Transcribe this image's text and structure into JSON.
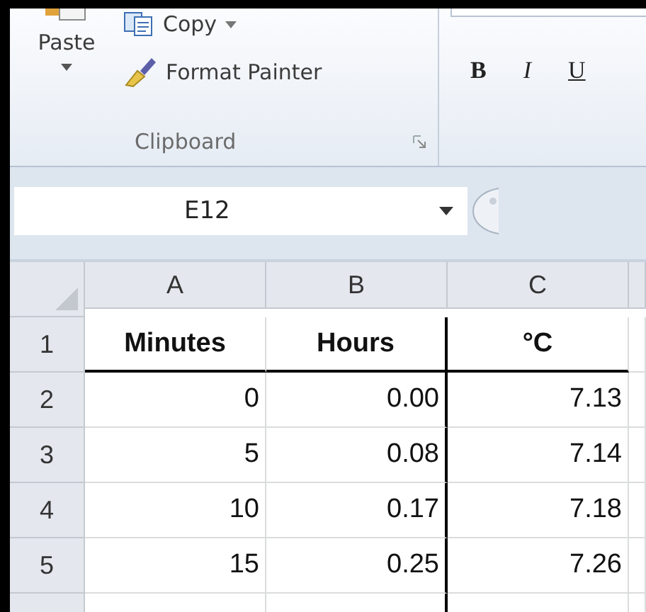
{
  "ribbon": {
    "clipboard": {
      "paste": {
        "label": "Paste"
      },
      "copy": {
        "label": "Copy"
      },
      "format_painter": {
        "label": "Format Painter"
      },
      "group_label": "Clipboard"
    },
    "font": {
      "buttons": [
        {
          "label": "B",
          "kind": "bold"
        },
        {
          "label": "I",
          "kind": "italic"
        },
        {
          "label": "U",
          "kind": "underline"
        }
      ]
    }
  },
  "name_box": {
    "value": "E12"
  },
  "sheet": {
    "columns": [
      "A",
      "B",
      "C"
    ],
    "rows": [
      {
        "number": "1",
        "kind": "header",
        "cells": [
          "Minutes",
          "Hours",
          "°C"
        ]
      },
      {
        "number": "2",
        "kind": "data",
        "cells": [
          "0",
          "0.00",
          "7.13"
        ]
      },
      {
        "number": "3",
        "kind": "data",
        "cells": [
          "5",
          "0.08",
          "7.14"
        ]
      },
      {
        "number": "4",
        "kind": "data",
        "cells": [
          "10",
          "0.17",
          "7.18"
        ]
      },
      {
        "number": "5",
        "kind": "data",
        "cells": [
          "15",
          "0.25",
          "7.26"
        ]
      }
    ]
  }
}
